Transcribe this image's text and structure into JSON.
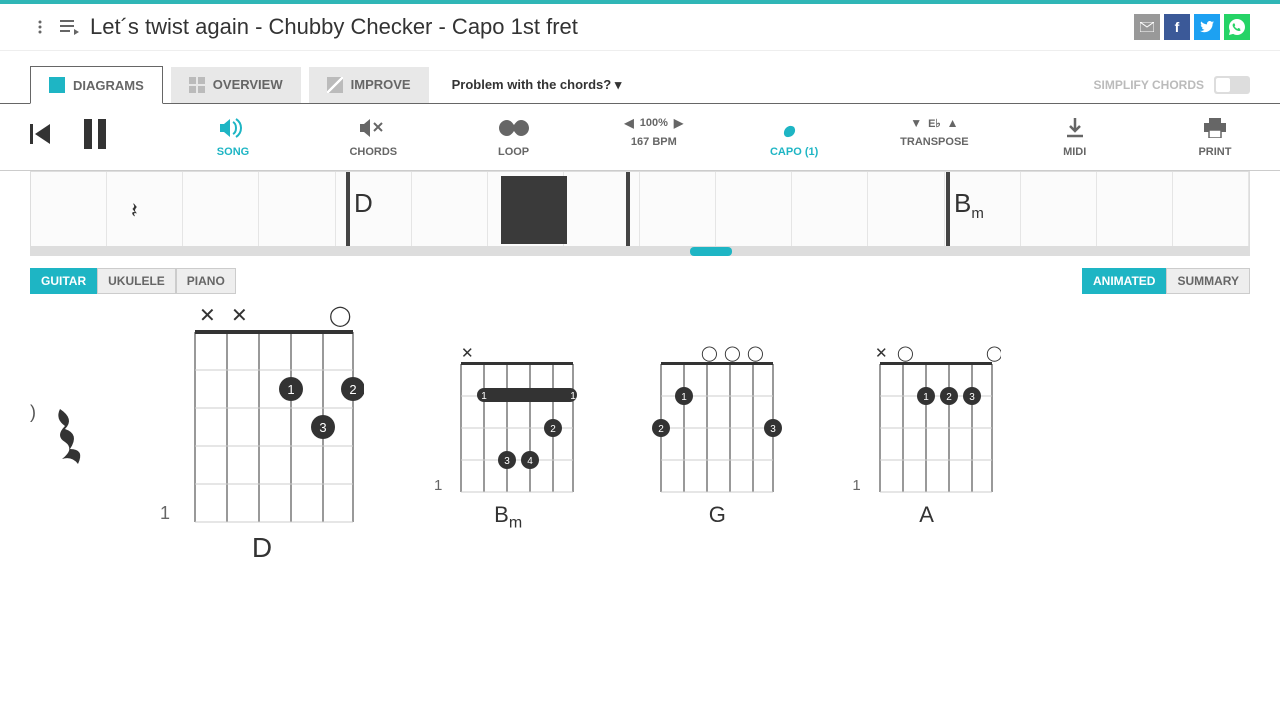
{
  "header": {
    "title": "Let´s twist again - Chubby Checker - Capo 1st fret"
  },
  "tabs": {
    "diagrams": "DIAGRAMS",
    "overview": "OVERVIEW",
    "improve": "IMPROVE",
    "problem": "Problem with the chords? ▾",
    "simplify": "SIMPLIFY CHORDS"
  },
  "toolbar": {
    "song": "SONG",
    "chords": "CHORDS",
    "loop": "LOOP",
    "speed_pct": "100%",
    "bpm": "167 BPM",
    "capo": "CAPO (1)",
    "transpose": "TRANSPOSE",
    "transpose_val": "E♭",
    "midi": "MIDI",
    "print": "PRINT"
  },
  "track": {
    "chord1": "D",
    "chord2": "Bm",
    "rest": "𝄽"
  },
  "instruments": {
    "guitar": "GUITAR",
    "ukulele": "UKULELE",
    "piano": "PIANO",
    "animated": "ANIMATED",
    "summary": "SUMMARY"
  },
  "chords": {
    "d": {
      "name": "D",
      "fret": "1",
      "top": "✕ ✕ ◯"
    },
    "bm": {
      "name": "Bm",
      "fret": "1",
      "top": "✕"
    },
    "g": {
      "name": "G",
      "fret": "",
      "top": "◯ ◯ ◯"
    },
    "a": {
      "name": "A",
      "fret": "1",
      "top": "✕ ◯        ◯"
    }
  }
}
